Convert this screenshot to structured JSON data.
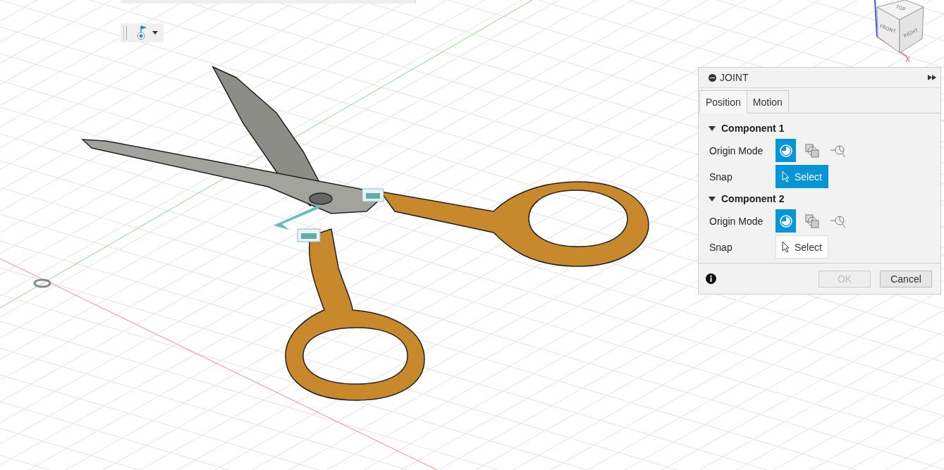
{
  "viewcube": {
    "top": "TOP",
    "front": "FRONT",
    "right": "RIGHT",
    "axis_x": "X"
  },
  "panel": {
    "title": "JOINT",
    "tabs": [
      {
        "label": "Position",
        "selected": true
      },
      {
        "label": "Motion",
        "selected": false
      }
    ],
    "sections": [
      {
        "title": "Component 1",
        "expanded": true,
        "origin_label": "Origin Mode",
        "modes": [
          {
            "kind": "circle",
            "selected": true
          },
          {
            "kind": "overlap",
            "selected": false
          },
          {
            "kind": "target",
            "selected": false
          }
        ],
        "snap_label": "Snap",
        "snap": {
          "label": "Select",
          "active": true
        }
      },
      {
        "title": "Component 2",
        "expanded": true,
        "origin_label": "Origin Mode",
        "modes": [
          {
            "kind": "circle",
            "selected": true
          },
          {
            "kind": "overlap",
            "selected": false
          },
          {
            "kind": "target",
            "selected": false
          }
        ],
        "snap_label": "Snap",
        "snap": {
          "label": "Select",
          "active": false
        }
      }
    ],
    "buttons": [
      {
        "label": "OK",
        "disabled": true
      },
      {
        "label": "Cancel",
        "disabled": false
      }
    ]
  }
}
